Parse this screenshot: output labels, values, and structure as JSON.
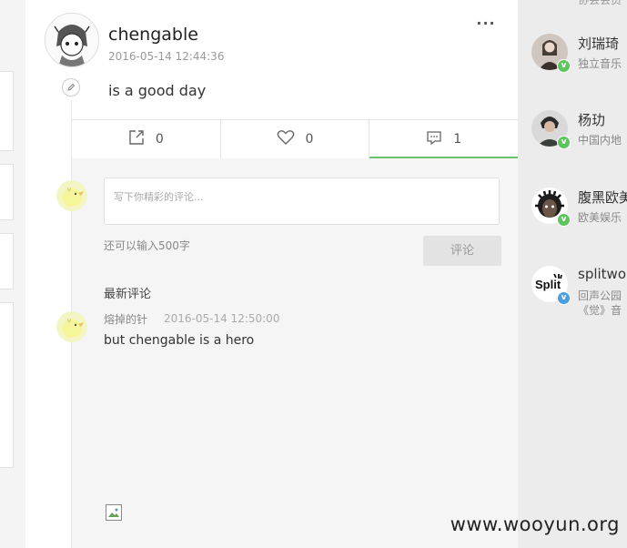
{
  "post": {
    "username": "chengable",
    "time": "2016-05-14 12:44:36",
    "content": "is a good day",
    "more_label": "···"
  },
  "actions": [
    {
      "name": "share",
      "icon": "share-icon",
      "count": "0"
    },
    {
      "name": "like",
      "icon": "heart-icon",
      "count": "0"
    },
    {
      "name": "comment",
      "icon": "comment-icon",
      "count": "1"
    }
  ],
  "comment_box": {
    "placeholder": "写下你精彩的评论...",
    "char_hint": "还可以输入500字",
    "submit_label": "评论"
  },
  "comments": {
    "title": "最新评论",
    "items": [
      {
        "user": "熔掉的针",
        "time": "2016-05-14 12:50:00",
        "text": "but chengable is a hero"
      }
    ]
  },
  "sidebar": {
    "top_cut_text": "协会会员",
    "users": [
      {
        "name": "刘瑞琦",
        "desc": "独立音乐",
        "badge": "v",
        "badge_color": "#5cc55c"
      },
      {
        "name": "杨玏",
        "desc": "中国内地",
        "badge": "v",
        "badge_color": "#5cc55c"
      },
      {
        "name": "腹黑欧美",
        "desc": "欧美娱乐",
        "badge": "v",
        "badge_color": "#5cc55c"
      },
      {
        "name": "splitwo",
        "desc": "回声公园",
        "desc2": "《觉》音",
        "badge": "v",
        "badge_color": "#4a9fe0"
      }
    ]
  },
  "watermark": "www.wooyun.org",
  "colors": {
    "accent": "#6cc26c"
  }
}
